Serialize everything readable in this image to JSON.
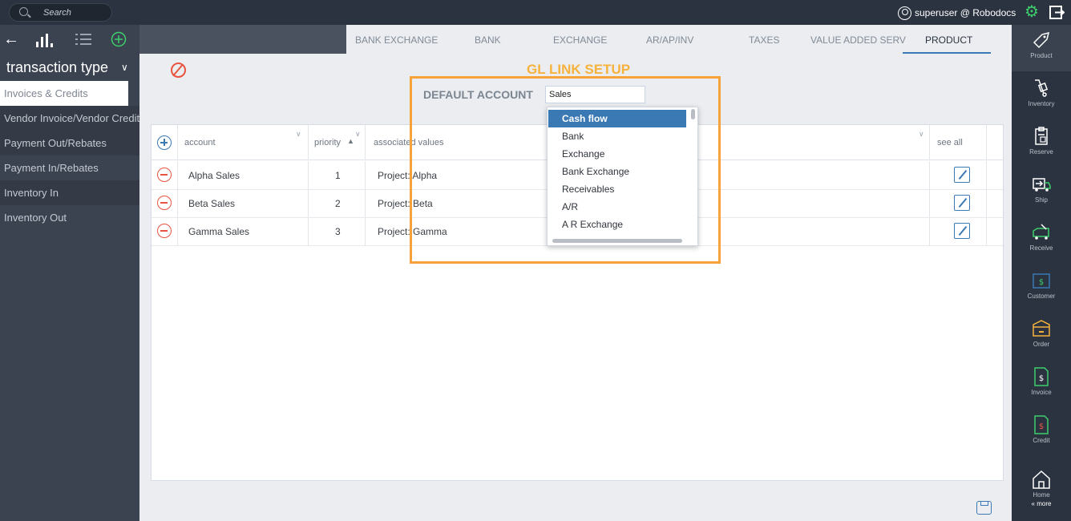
{
  "topbar": {
    "search_placeholder": "Search",
    "user_label": "superuser @ Robodocs"
  },
  "leftbar": {
    "section_title": "transaction type",
    "items": [
      {
        "label": "Invoices & Credits",
        "active": true
      },
      {
        "label": "Vendor Invoice/Vendor Credit"
      },
      {
        "label": "Payment Out/Rebates"
      },
      {
        "label": "Payment In/Rebates"
      },
      {
        "label": "Inventory In"
      },
      {
        "label": "Inventory Out"
      }
    ]
  },
  "tabs": [
    {
      "label": "BANK EXCHANGE"
    },
    {
      "label": "BANK"
    },
    {
      "label": "EXCHANGE"
    },
    {
      "label": "AR/AP/INV"
    },
    {
      "label": "TAXES"
    },
    {
      "label": "VALUE ADDED SERV"
    },
    {
      "label": "PRODUCT",
      "active": true
    }
  ],
  "main": {
    "title": "GL LINK SETUP",
    "default_account_label": "DEFAULT ACCOUNT",
    "default_account_value": "Sales"
  },
  "table": {
    "headers": {
      "account": "account",
      "priority": "priority",
      "associated": "associated values",
      "see_all": "see all"
    },
    "rows": [
      {
        "account": "Alpha Sales",
        "priority": "1",
        "assoc": "Project: Alpha"
      },
      {
        "account": "Beta Sales",
        "priority": "2",
        "assoc": "Project: Beta"
      },
      {
        "account": "Gamma Sales",
        "priority": "3",
        "assoc": "Project: Gamma"
      }
    ]
  },
  "dropdown": {
    "options": [
      "Cash flow",
      "Bank",
      "Exchange",
      "Bank Exchange",
      "Receivables",
      "A/R",
      "A R Exchange"
    ],
    "selected": "Cash flow"
  },
  "rightbar": {
    "items": [
      "Product",
      "Inventory",
      "Reserve",
      "Ship",
      "Receive",
      "Customer",
      "Order",
      "Invoice",
      "Credit",
      "Home"
    ],
    "more": "« more"
  },
  "colors": {
    "accent": "#3a79b3",
    "highlight": "#f6a43a",
    "danger": "#e8543f",
    "topbar": "#2b3340"
  }
}
